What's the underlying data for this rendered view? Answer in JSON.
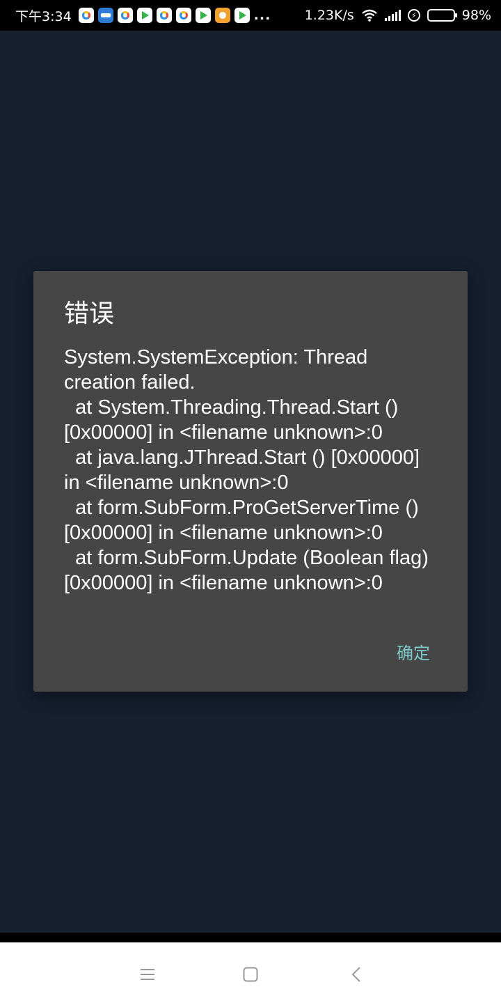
{
  "status_bar": {
    "time": "下午3:34",
    "notification_icons": [
      "app-a-icon",
      "app-b-icon",
      "app-a-icon",
      "play-icon",
      "app-a-icon",
      "app-a-icon",
      "play-icon",
      "app-c-icon",
      "play-icon"
    ],
    "more": "...",
    "network_speed": "1.23K/s",
    "battery_percent": "98%",
    "battery_level": 0.98
  },
  "dialog": {
    "title": "错误",
    "message": "System.SystemException: Thread creation failed.\n  at System.Threading.Thread.Start () [0x00000] in <filename unknown>:0\n  at java.lang.JThread.Start () [0x00000] in <filename unknown>:0\n  at form.SubForm.ProGetServerTime () [0x00000] in <filename unknown>:0\n  at form.SubForm.Update (Boolean flag) [0x00000] in <filename unknown>:0",
    "ok_label": "确定"
  },
  "colors": {
    "background": "#151f2e",
    "dialog_bg": "#464646",
    "accent": "#7ec9c9"
  }
}
